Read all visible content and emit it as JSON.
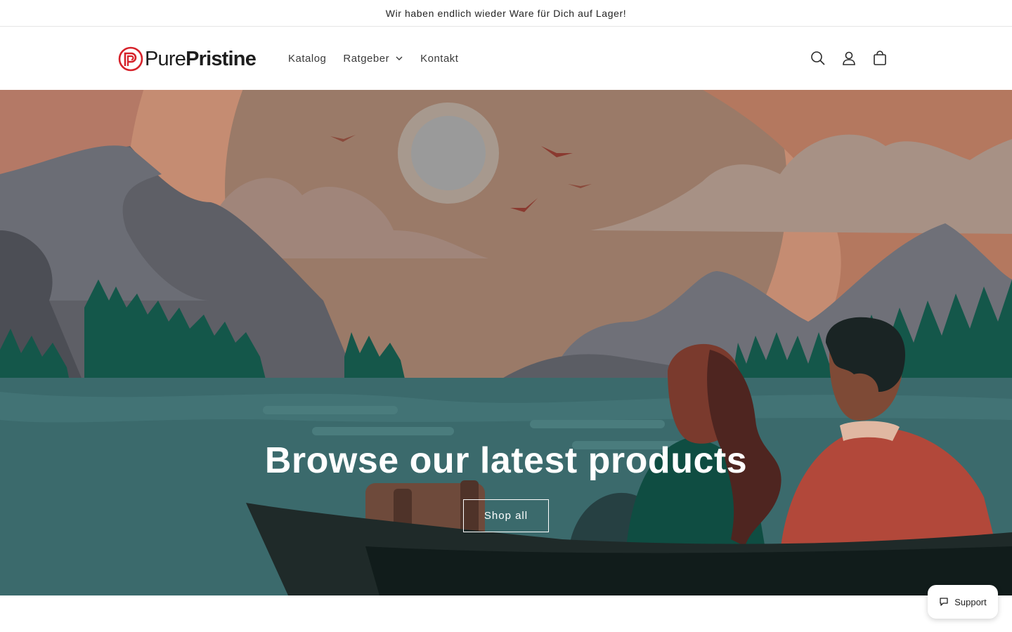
{
  "announcement": {
    "text": "Wir haben endlich wieder Ware für Dich auf Lager!"
  },
  "header": {
    "logo": {
      "part1": "Pure",
      "part2": "Pristine",
      "color": "#d6222a"
    },
    "nav": [
      {
        "label": "Katalog"
      },
      {
        "label": "Ratgeber",
        "has_dropdown": true
      },
      {
        "label": "Kontakt"
      }
    ],
    "icons": [
      "search-icon",
      "account-icon",
      "cart-icon"
    ]
  },
  "hero": {
    "title": "Browse our latest products",
    "button_label": "Shop all"
  },
  "support": {
    "label": "Support",
    "icon": "chat-icon"
  },
  "colors": {
    "sky": "#bf8a74",
    "lake": "#3b6a6c",
    "boat": "#1f2a29",
    "trees": "#14574a",
    "brand": "#d6222a"
  }
}
